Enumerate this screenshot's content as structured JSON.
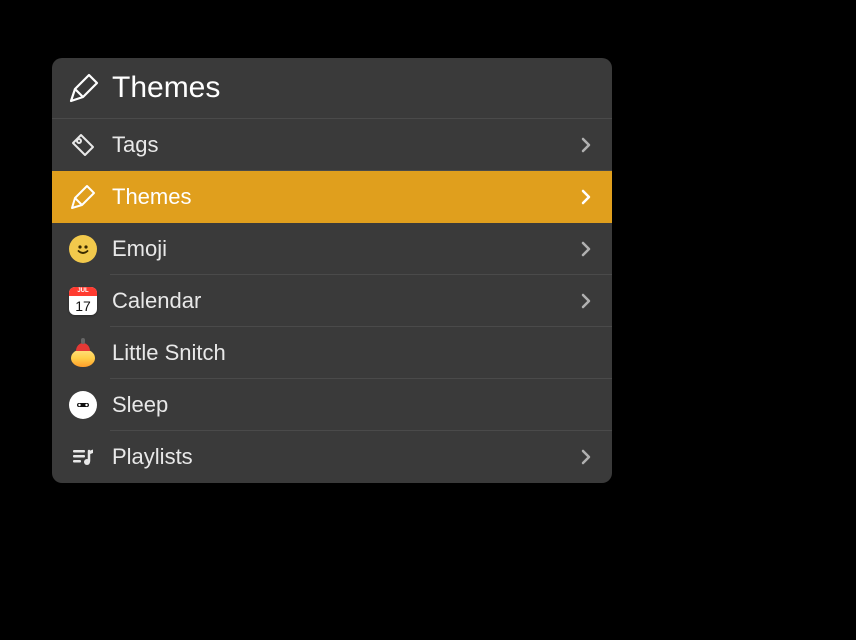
{
  "header": {
    "title": "Themes"
  },
  "items": [
    {
      "label": "Tags",
      "icon": "tag-icon",
      "has_children": true,
      "selected": false
    },
    {
      "label": "Themes",
      "icon": "brush-icon",
      "has_children": true,
      "selected": true
    },
    {
      "label": "Emoji",
      "icon": "emoji-icon",
      "has_children": true,
      "selected": false
    },
    {
      "label": "Calendar",
      "icon": "calendar-icon",
      "has_children": true,
      "selected": false
    },
    {
      "label": "Little Snitch",
      "icon": "little-snitch-icon",
      "has_children": false,
      "selected": false
    },
    {
      "label": "Sleep",
      "icon": "sleep-icon",
      "has_children": false,
      "selected": false
    },
    {
      "label": "Playlists",
      "icon": "playlist-icon",
      "has_children": true,
      "selected": false
    }
  ],
  "calendar": {
    "month": "JUL",
    "day": "17"
  }
}
